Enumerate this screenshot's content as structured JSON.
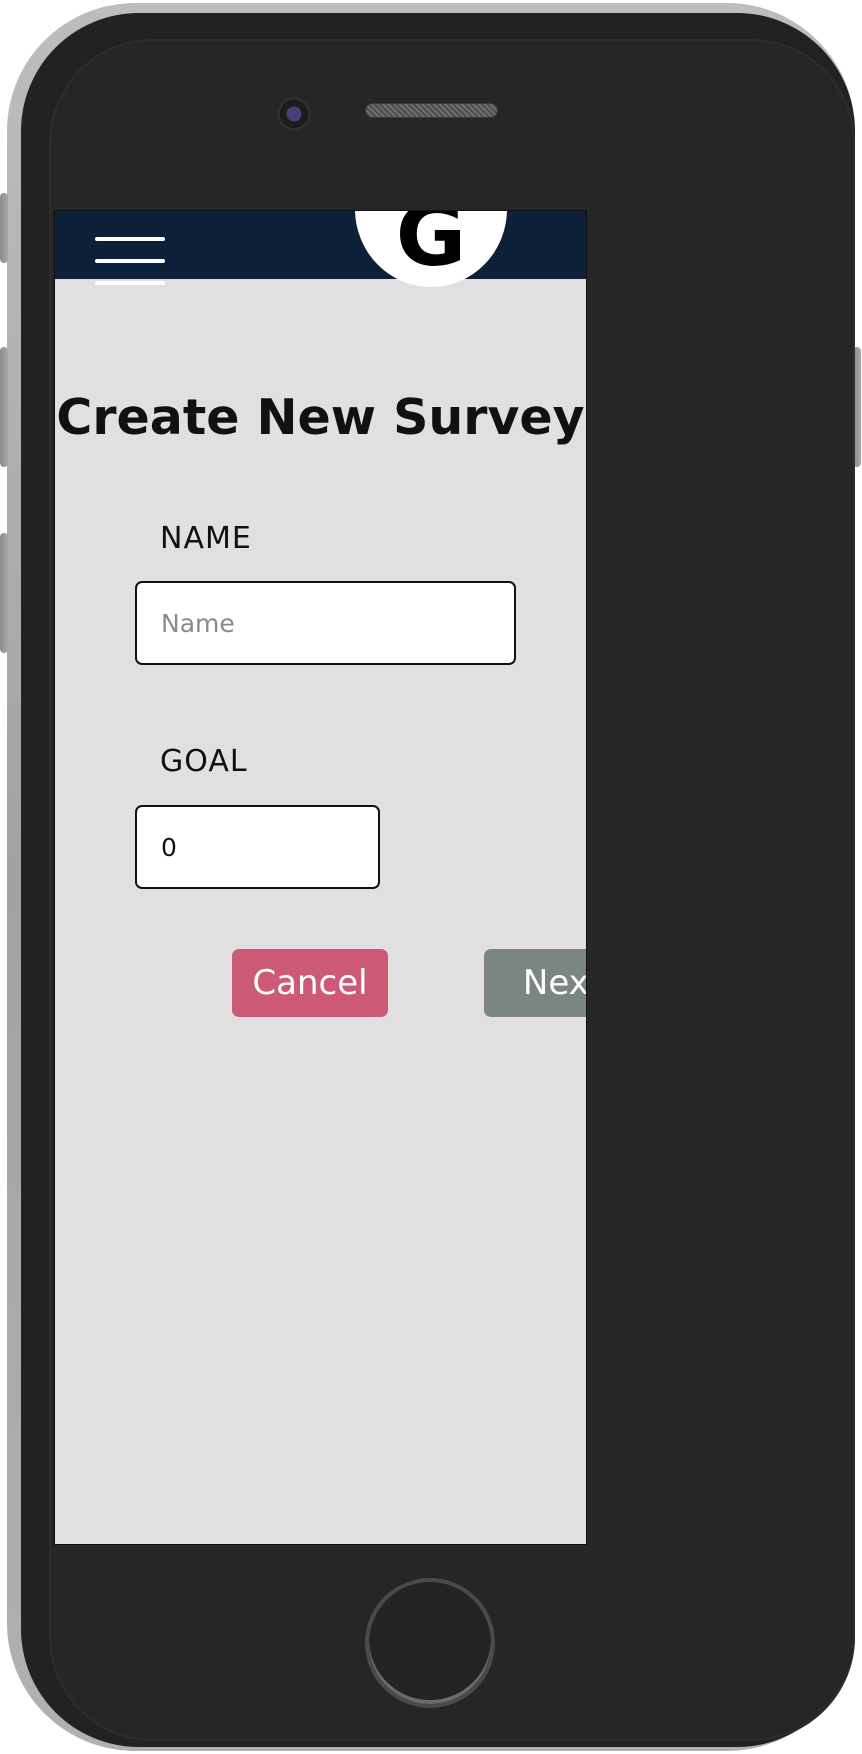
{
  "header": {
    "logo_letter": "G"
  },
  "page": {
    "title": "Create New Survey"
  },
  "form": {
    "name_label": "NAME",
    "name_placeholder": "Name",
    "name_value": "",
    "goal_label": "GOAL",
    "goal_value": "0"
  },
  "actions": {
    "cancel_label": "Cancel",
    "next_label": "Next"
  },
  "colors": {
    "header_bg": "#0c2138",
    "screen_bg": "#e1dfdf",
    "cancel_bg": "#cc5a77",
    "next_bg": "#7b8680"
  }
}
